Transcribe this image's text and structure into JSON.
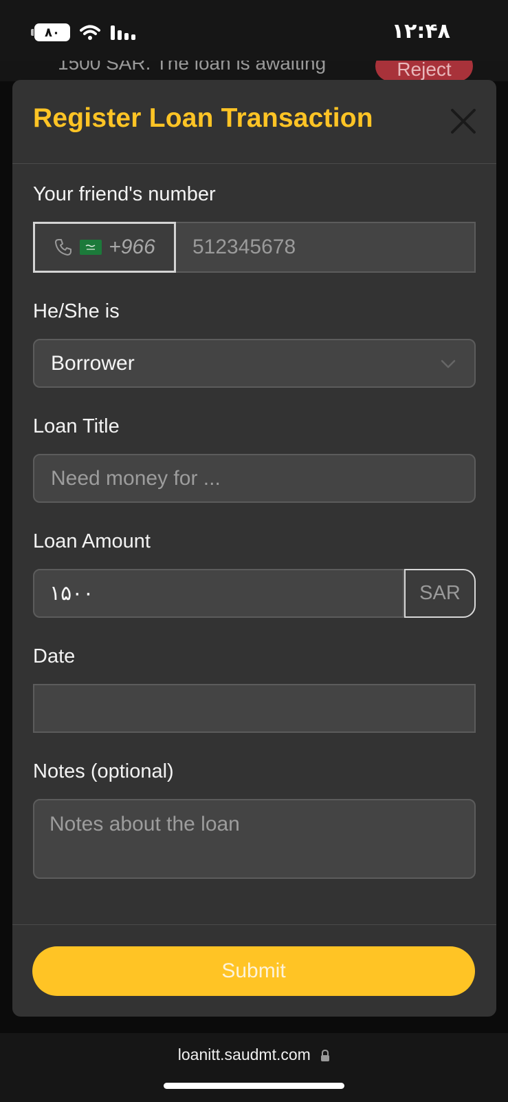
{
  "status_bar": {
    "battery": "۸۰",
    "time": "۱۲:۴۸"
  },
  "background": {
    "notification_text": "1500 SAR. The loan is awaiting",
    "reject_label": "Reject"
  },
  "modal": {
    "title": "Register Loan Transaction",
    "fields": {
      "friend_number": {
        "label": "Your friend's number",
        "country_code": "+966",
        "placeholder": "512345678"
      },
      "role": {
        "label": "He/She is",
        "value": "Borrower"
      },
      "loan_title": {
        "label": "Loan Title",
        "placeholder": "Need money for ..."
      },
      "loan_amount": {
        "label": "Loan Amount",
        "value": "۱۵۰۰",
        "currency": "SAR"
      },
      "date": {
        "label": "Date",
        "value": ""
      },
      "notes": {
        "label": "Notes (optional)",
        "placeholder": "Notes about the loan"
      }
    },
    "submit_label": "Submit"
  },
  "browser": {
    "url": "loanitt.saudmt.com"
  },
  "colors": {
    "accent": "#ffc425",
    "modal_bg": "#333333",
    "field_bg": "#444444"
  }
}
